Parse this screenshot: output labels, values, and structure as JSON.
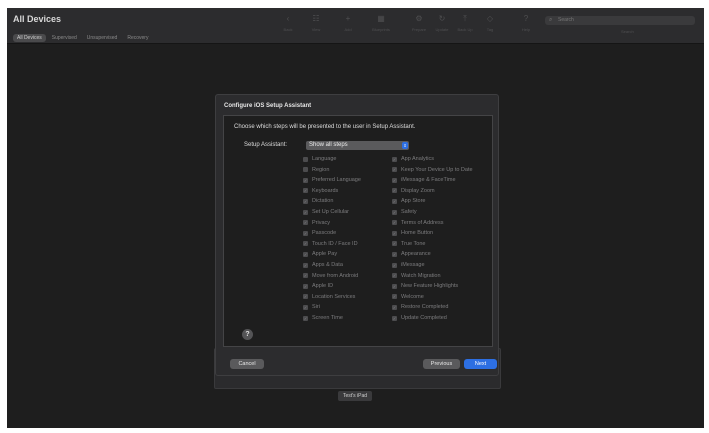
{
  "window": {
    "title": "All Devices",
    "filters": [
      "All Devices",
      "Supervised",
      "Unsupervised",
      "Recovery"
    ],
    "toolbar": [
      "Back",
      "View",
      "Add",
      "Blueprints",
      "Prepare",
      "Update",
      "Back Up",
      "Tag",
      "Help"
    ],
    "search": {
      "placeholder": "Search",
      "label": "Search"
    }
  },
  "device_label": "Test's iPad",
  "dialog": {
    "title": "Configure iOS Setup Assistant",
    "instructions": "Choose which steps will be presented to the user in Setup Assistant.",
    "setup_assistant_label": "Setup Assistant:",
    "setup_assistant_value": "Show all steps",
    "left_steps": [
      {
        "label": "Language",
        "checked": false
      },
      {
        "label": "Region",
        "checked": false
      },
      {
        "label": "Preferred Language",
        "checked": true
      },
      {
        "label": "Keyboards",
        "checked": true
      },
      {
        "label": "Dictation",
        "checked": true
      },
      {
        "label": "Set Up Cellular",
        "checked": true
      },
      {
        "label": "Privacy",
        "checked": true
      },
      {
        "label": "Passcode",
        "checked": true
      },
      {
        "label": "Touch ID / Face ID",
        "checked": true
      },
      {
        "label": "Apple Pay",
        "checked": true
      },
      {
        "label": "Apps & Data",
        "checked": true
      },
      {
        "label": "Move from Android",
        "checked": true
      },
      {
        "label": "Apple ID",
        "checked": true
      },
      {
        "label": "Location Services",
        "checked": true
      },
      {
        "label": "Siri",
        "checked": true
      },
      {
        "label": "Screen Time",
        "checked": true
      }
    ],
    "right_steps": [
      {
        "label": "App Analytics",
        "checked": true
      },
      {
        "label": "Keep Your Device Up to Date",
        "checked": true
      },
      {
        "label": "iMessage & FaceTime",
        "checked": true
      },
      {
        "label": "Display Zoom",
        "checked": true
      },
      {
        "label": "App Store",
        "checked": true
      },
      {
        "label": "Safety",
        "checked": true
      },
      {
        "label": "Terms of Address",
        "checked": true
      },
      {
        "label": "Home Button",
        "checked": true
      },
      {
        "label": "True Tone",
        "checked": true
      },
      {
        "label": "Appearance",
        "checked": true
      },
      {
        "label": "iMessage",
        "checked": true
      },
      {
        "label": "Watch Migration",
        "checked": true
      },
      {
        "label": "New Feature Highlights",
        "checked": true
      },
      {
        "label": "Welcome",
        "checked": true
      },
      {
        "label": "Restore Completed",
        "checked": true
      },
      {
        "label": "Update Completed",
        "checked": true
      }
    ],
    "help": "?",
    "cancel": "Cancel",
    "previous": "Previous",
    "next": "Next"
  }
}
